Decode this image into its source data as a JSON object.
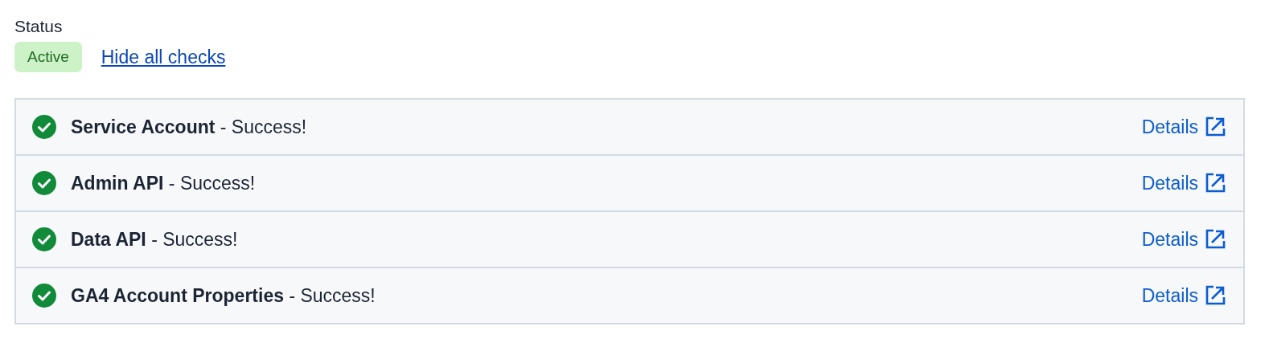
{
  "status": {
    "label": "Status",
    "badge": "Active",
    "toggle_link": "Hide all checks"
  },
  "checks": [
    {
      "name": "Service Account",
      "separator": "-",
      "result": "Success!",
      "kind": "success",
      "link": "Details"
    },
    {
      "name": "Admin API",
      "separator": "-",
      "result": "Success!",
      "kind": "success",
      "link": "Details"
    },
    {
      "name": "Data API",
      "separator": "-",
      "result": "Success!",
      "kind": "success",
      "link": "Details"
    },
    {
      "name": "GA4 Account Properties",
      "separator": "-",
      "result": "Success!",
      "kind": "success",
      "link": "Details"
    }
  ]
}
